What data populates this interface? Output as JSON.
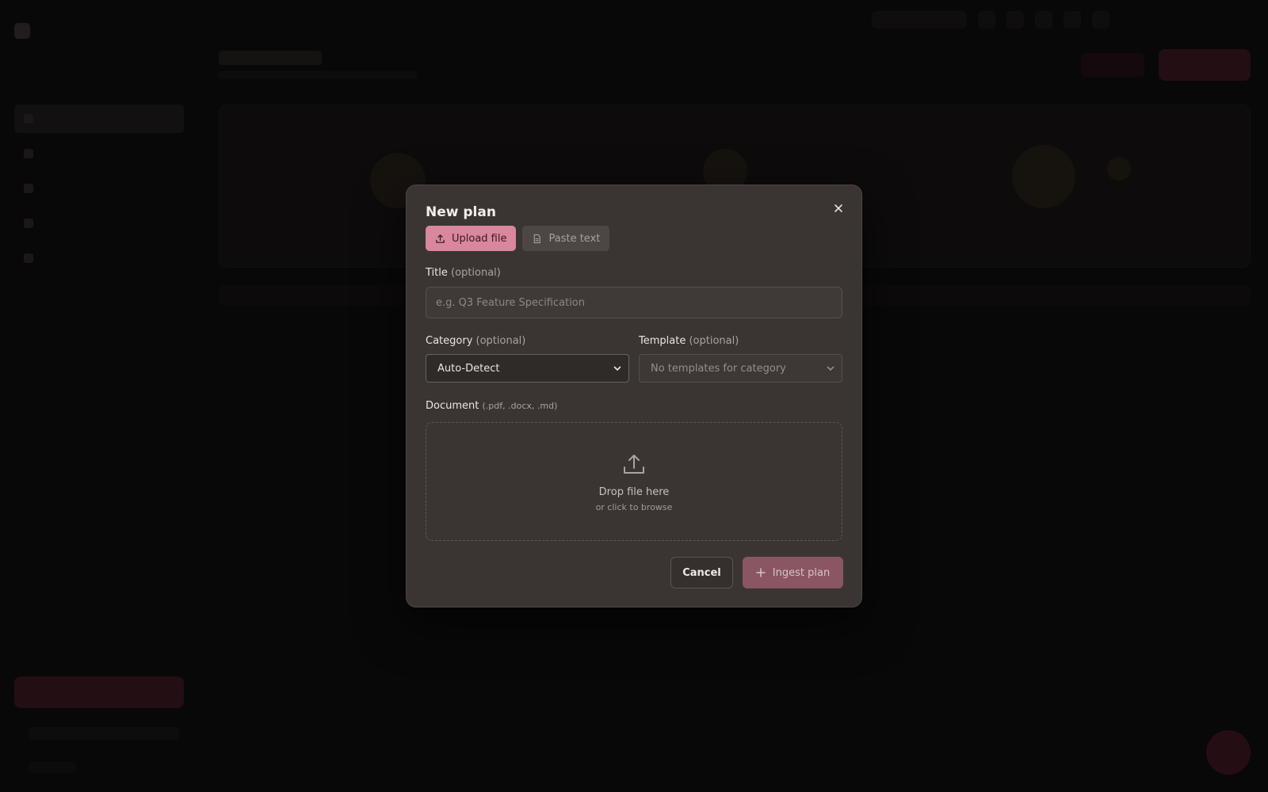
{
  "modal": {
    "title": "New plan",
    "tabs": {
      "upload_label": "Upload file",
      "paste_label": "Paste text"
    },
    "title_field": {
      "label": "Title",
      "optional": "(optional)",
      "placeholder": "e.g. Q3 Feature Specification",
      "value": ""
    },
    "category_field": {
      "label": "Category",
      "optional": "(optional)",
      "selected": "Auto-Detect"
    },
    "template_field": {
      "label": "Template",
      "optional": "(optional)",
      "selected": "No templates for category"
    },
    "document_field": {
      "label": "Document",
      "hint": "(.pdf, .docx, .md)",
      "drop_main": "Drop file here",
      "drop_sub": "or click to browse"
    },
    "actions": {
      "cancel_label": "Cancel",
      "submit_label": "Ingest plan"
    }
  },
  "colors": {
    "accent": "#d9879c",
    "modal_bg": "#3a3532",
    "backdrop": "#0b0a0a"
  },
  "icons": {
    "close": "close-icon",
    "upload": "upload-icon",
    "document": "document-icon",
    "plus": "plus-icon",
    "chevron": "chevron-down-icon"
  }
}
